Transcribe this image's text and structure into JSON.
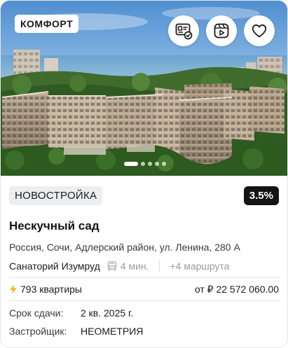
{
  "photo": {
    "class_badge": "КОМФОРТ",
    "actions": [
      {
        "name": "certificate",
        "icon": "certificate-check-icon"
      },
      {
        "name": "video",
        "icon": "video-reel-icon"
      },
      {
        "name": "favorite",
        "icon": "heart-icon"
      }
    ],
    "carousel": {
      "total": 5,
      "active": 1
    }
  },
  "tags": {
    "status": "НОВОСТРОЙКА",
    "rate": "3.5%"
  },
  "title": "Нескучный сад",
  "address": "Россия, Сочи, Адлерский район, ул. Ленина, 280 А",
  "station": {
    "name": "Санаторий Изумруд",
    "icon": "transit-icon",
    "time": "4 мин.",
    "routes": "+4 маршрута"
  },
  "stats": {
    "icon": "bolt-icon",
    "flats": "793 квартиры",
    "price": "от ₽ 22 572 060.00"
  },
  "details": [
    {
      "label": "Срок сдачи:",
      "value": "2 кв. 2025 г."
    },
    {
      "label": "Застройщик:",
      "value": "НЕОМЕТРИЯ"
    }
  ],
  "colors": {
    "accent_bolt": "#f2b705",
    "dark_badge": "#141414",
    "tag_bg": "#eceff1"
  }
}
